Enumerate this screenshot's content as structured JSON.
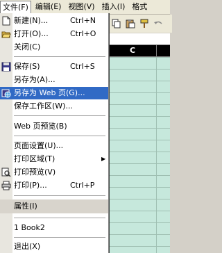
{
  "menubar": {
    "file": "文件(F)",
    "edit": "编辑(E)",
    "view": "视图(V)",
    "insert": "插入(I)",
    "format": "格式"
  },
  "sheet": {
    "column_c": "C"
  },
  "file_menu": {
    "new_label": "新建(N)...",
    "new_shortcut": "Ctrl+N",
    "open_label": "打开(O)...",
    "open_shortcut": "Ctrl+O",
    "close_label": "关闭(C)",
    "save_label": "保存(S)",
    "save_shortcut": "Ctrl+S",
    "save_as_label": "另存为(A)...",
    "save_as_web_label": "另存为 Web 页(G)...",
    "save_workspace_label": "保存工作区(W)...",
    "web_preview_label": "Web 页预览(B)",
    "page_setup_label": "页面设置(U)...",
    "print_area_label": "打印区域(T)",
    "print_preview_label": "打印预览(V)",
    "print_label": "打印(P)...",
    "print_shortcut": "Ctrl+P",
    "properties_label": "属性(I)",
    "recent_file_label": "1 Book2",
    "exit_label": "退出(X)"
  },
  "colors": {
    "highlight": "#316ac5",
    "sheet_bg": "#c6e8dc",
    "menubar_bg": "#ece9d8"
  }
}
